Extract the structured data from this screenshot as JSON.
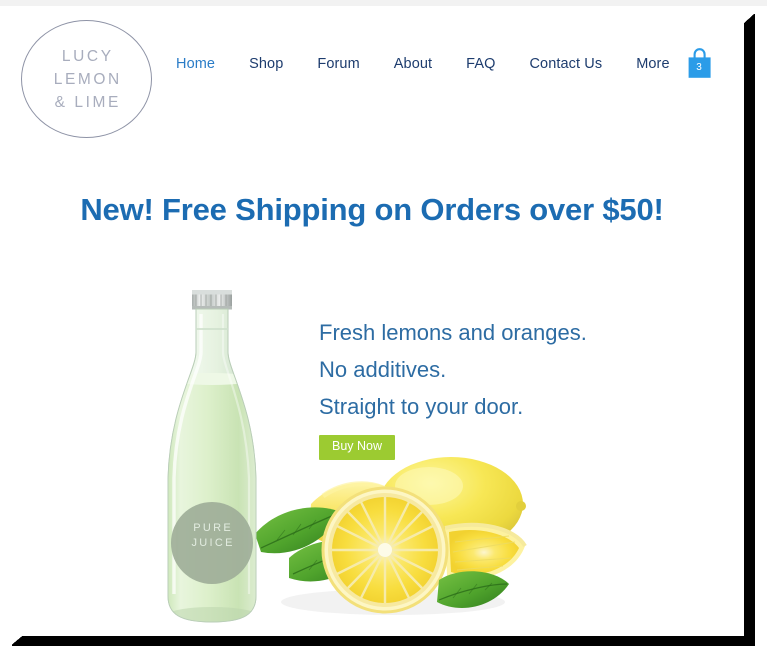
{
  "brand": {
    "logo_lines": [
      "LUCY",
      "LEMON",
      "& LIME"
    ]
  },
  "nav": {
    "items": [
      {
        "label": "Home",
        "active": true
      },
      {
        "label": "Shop",
        "active": false
      },
      {
        "label": "Forum",
        "active": false
      },
      {
        "label": "About",
        "active": false
      },
      {
        "label": "FAQ",
        "active": false
      },
      {
        "label": "Contact Us",
        "active": false
      },
      {
        "label": "More",
        "active": false
      }
    ],
    "cart": {
      "icon": "shopping-bag-icon",
      "count": "3"
    }
  },
  "promo": {
    "text": "New! Free Shipping on Orders over $50!"
  },
  "hero": {
    "lines": [
      "Fresh lemons and oranges.",
      "No additives.",
      "Straight to your door."
    ],
    "cta_label": "Buy Now",
    "product": {
      "label_line_1": "PURE",
      "label_line_2": "JUICE"
    }
  },
  "colors": {
    "nav_link": "#1d3c6e",
    "nav_link_active": "#2a7cc7",
    "promo_blue": "#1c6cb2",
    "body_blue": "#2d6ca3",
    "cta_green": "#9ccb31",
    "cart_blue": "#2b9ce8",
    "juice_green": "#d8ecc4",
    "label_gray": "#9fae99"
  }
}
